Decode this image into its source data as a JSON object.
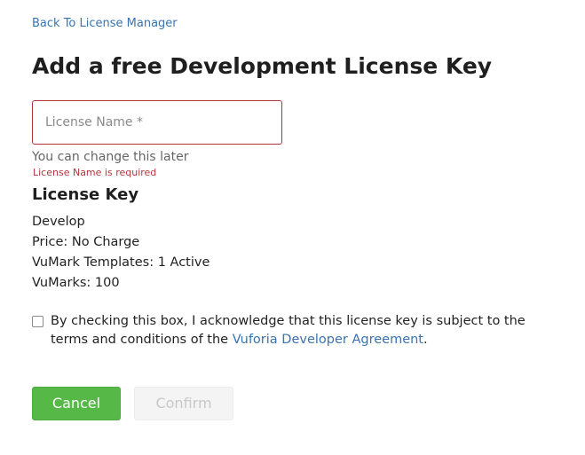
{
  "nav": {
    "back_link": "Back To License Manager"
  },
  "page": {
    "title": "Add a free Development License Key"
  },
  "form": {
    "license_name": {
      "value": "",
      "placeholder": "License Name *",
      "helper": "You can change this later",
      "error": "License Name is required"
    }
  },
  "license_key": {
    "heading": "License Key",
    "details": [
      "Develop",
      "Price: No Charge",
      "VuMark Templates: 1 Active",
      "VuMarks: 100"
    ]
  },
  "agreement": {
    "checked": false,
    "text_before": "By checking this box, I acknowledge that this license key is subject to the terms and conditions of the ",
    "link_text": "Vuforia Developer Agreement",
    "text_after": "."
  },
  "actions": {
    "cancel_label": "Cancel",
    "confirm_label": "Confirm",
    "confirm_enabled": false
  },
  "colors": {
    "link": "#3a73b0",
    "error": "#b5343c",
    "primary_button": "#56b947",
    "disabled_button_bg": "#f4f4f4",
    "disabled_button_text": "#c8c8c8"
  }
}
